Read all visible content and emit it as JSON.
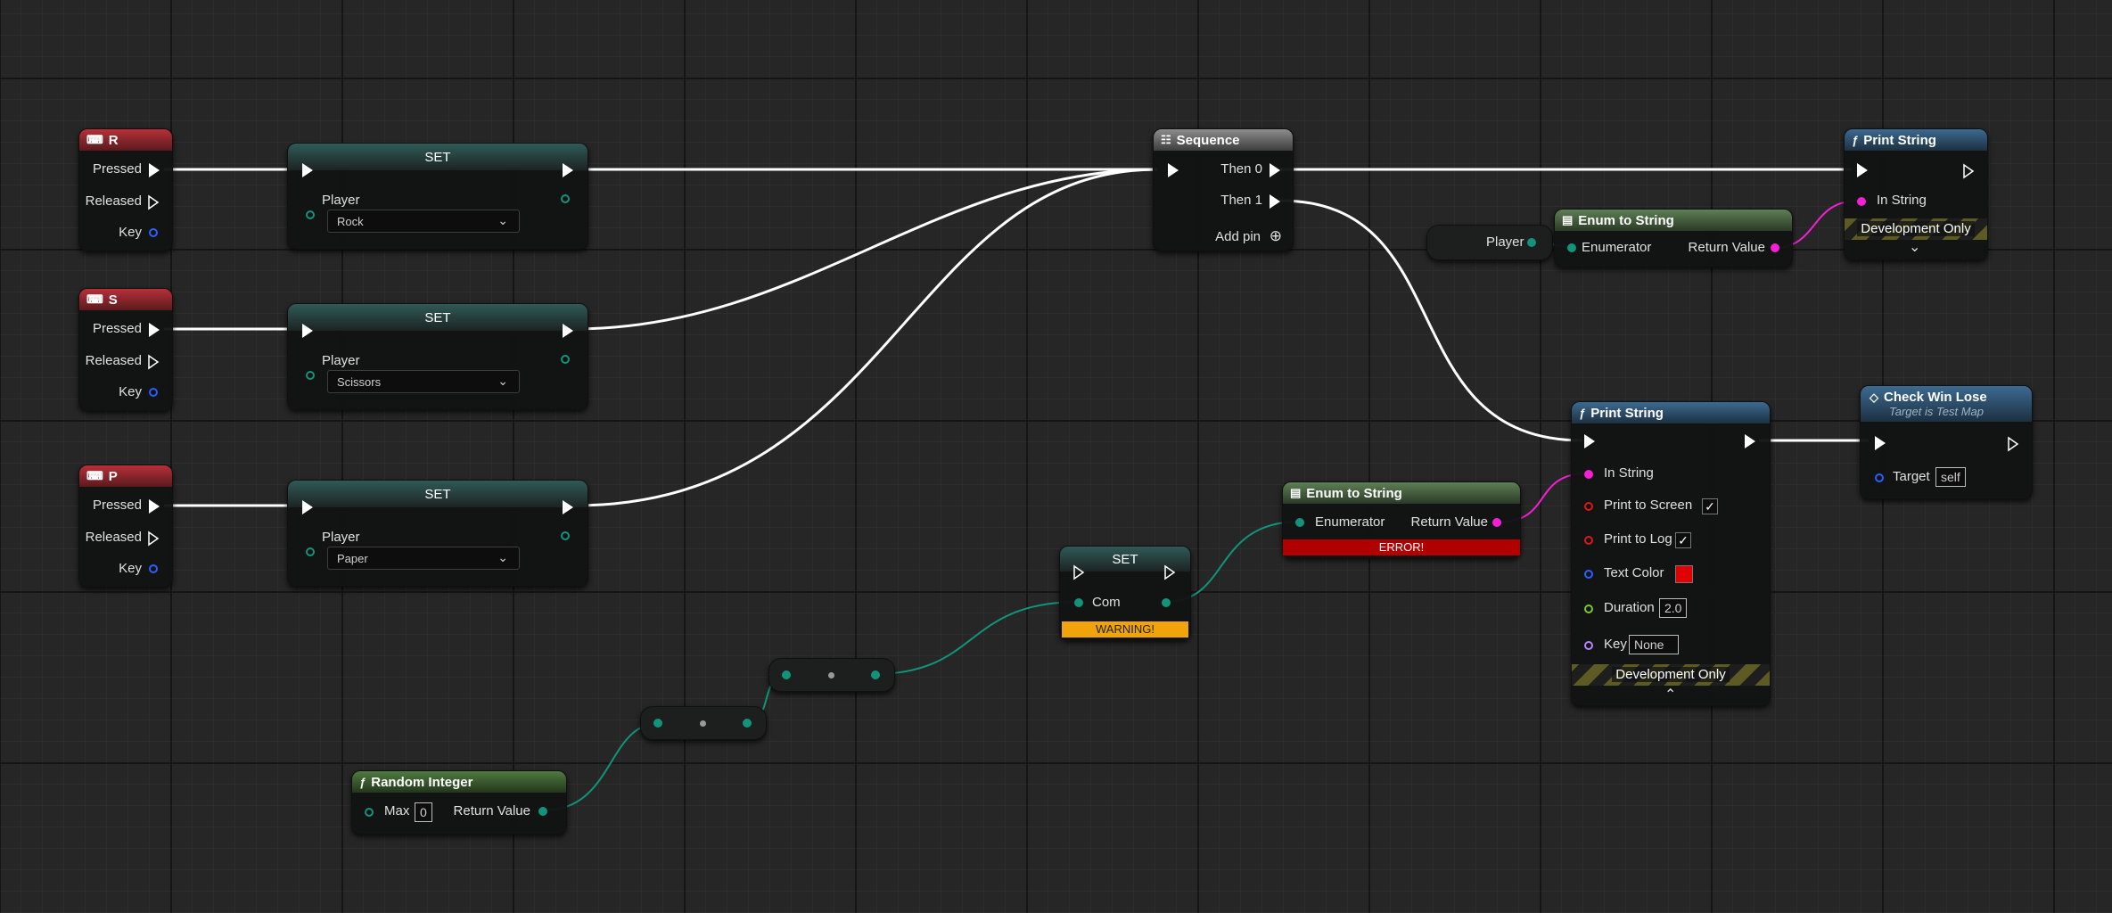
{
  "key_nodes": [
    {
      "title": "R",
      "pins": [
        "Pressed",
        "Released",
        "Key"
      ]
    },
    {
      "title": "S",
      "pins": [
        "Pressed",
        "Released",
        "Key"
      ]
    },
    {
      "title": "P",
      "pins": [
        "Pressed",
        "Released",
        "Key"
      ]
    }
  ],
  "set_nodes": [
    {
      "title": "SET",
      "var": "Player",
      "value": "Rock"
    },
    {
      "title": "SET",
      "var": "Player",
      "value": "Scissors"
    },
    {
      "title": "SET",
      "var": "Player",
      "value": "Paper"
    }
  ],
  "sequence": {
    "title": "Sequence",
    "then0": "Then 0",
    "then1": "Then 1",
    "add_pin": "Add pin"
  },
  "print_top": {
    "title": "Print String",
    "in_string": "In String",
    "dev": "Development Only"
  },
  "player_getter": {
    "label": "Player"
  },
  "enum_top": {
    "title": "Enum to String",
    "enumerator": "Enumerator",
    "return": "Return Value"
  },
  "print_main": {
    "title": "Print String",
    "in_string": "In String",
    "print_screen": "Print to Screen",
    "print_log": "Print to Log",
    "text_color": "Text Color",
    "duration": "Duration",
    "duration_value": "2.0",
    "key": "Key",
    "key_value": "None",
    "dev": "Development Only",
    "text_color_hex": "#e00000"
  },
  "check_win": {
    "title": "Check Win Lose",
    "subtitle": "Target is Test Map",
    "target": "Target",
    "target_value": "self"
  },
  "enum_err": {
    "title": "Enum to String",
    "enumerator": "Enumerator",
    "return": "Return Value",
    "error": "ERROR!"
  },
  "set_com": {
    "title": "SET",
    "var": "Com",
    "warning": "WARNING!"
  },
  "random_int": {
    "title": "Random Integer",
    "max": "Max",
    "max_value": "0",
    "return": "Return Value"
  },
  "colors": {
    "exec": "#ffffff",
    "byte_pin": "#12937c",
    "string_pin": "#f41fd7",
    "error": "#b10000",
    "warning": "#f0a30a"
  }
}
